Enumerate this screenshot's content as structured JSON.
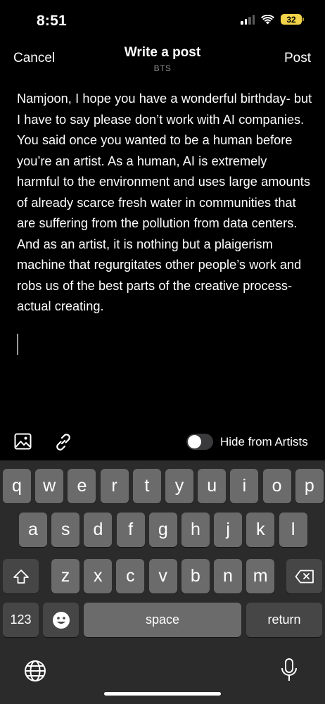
{
  "status_bar": {
    "time": "8:51",
    "battery": "32",
    "icons": [
      "signal-icon",
      "wifi-icon",
      "battery-icon"
    ]
  },
  "nav": {
    "cancel_label": "Cancel",
    "title": "Write a post",
    "subtitle": "BTS",
    "post_label": "Post"
  },
  "post": {
    "text": "Namjoon, I hope you have a wonderful birthday- but I have to say please don’t work with AI companies. You said once you wanted to be a human before you’re an artist. As a human, AI is extremely harmful to the environment and uses large amounts of already scarce fresh water in communities that are suffering from the pollution from data centers. And as an artist, it is nothing but a plaigerism machine that regurgitates other people’s work and robs us of the best parts of the creative process- actual creating."
  },
  "toolbar": {
    "hide_label": "Hide from Artists",
    "hide_on": false,
    "icons": [
      "image-icon",
      "link-icon"
    ]
  },
  "keyboard": {
    "row1": [
      "q",
      "w",
      "e",
      "r",
      "t",
      "y",
      "u",
      "i",
      "o",
      "p"
    ],
    "row2": [
      "a",
      "s",
      "d",
      "f",
      "g",
      "h",
      "j",
      "k",
      "l"
    ],
    "row3": [
      "z",
      "x",
      "c",
      "v",
      "b",
      "n",
      "m"
    ],
    "numbers_label": "123",
    "space_label": "space",
    "return_label": "return",
    "icons": [
      "shift-icon",
      "delete-icon",
      "emoji-icon",
      "globe-icon",
      "microphone-icon"
    ]
  },
  "colors": {
    "background": "#000000",
    "keyboard_bg": "#2b2b2b",
    "key": "#6b6b6b",
    "special_key": "#464646",
    "battery": "#f2d44a"
  }
}
